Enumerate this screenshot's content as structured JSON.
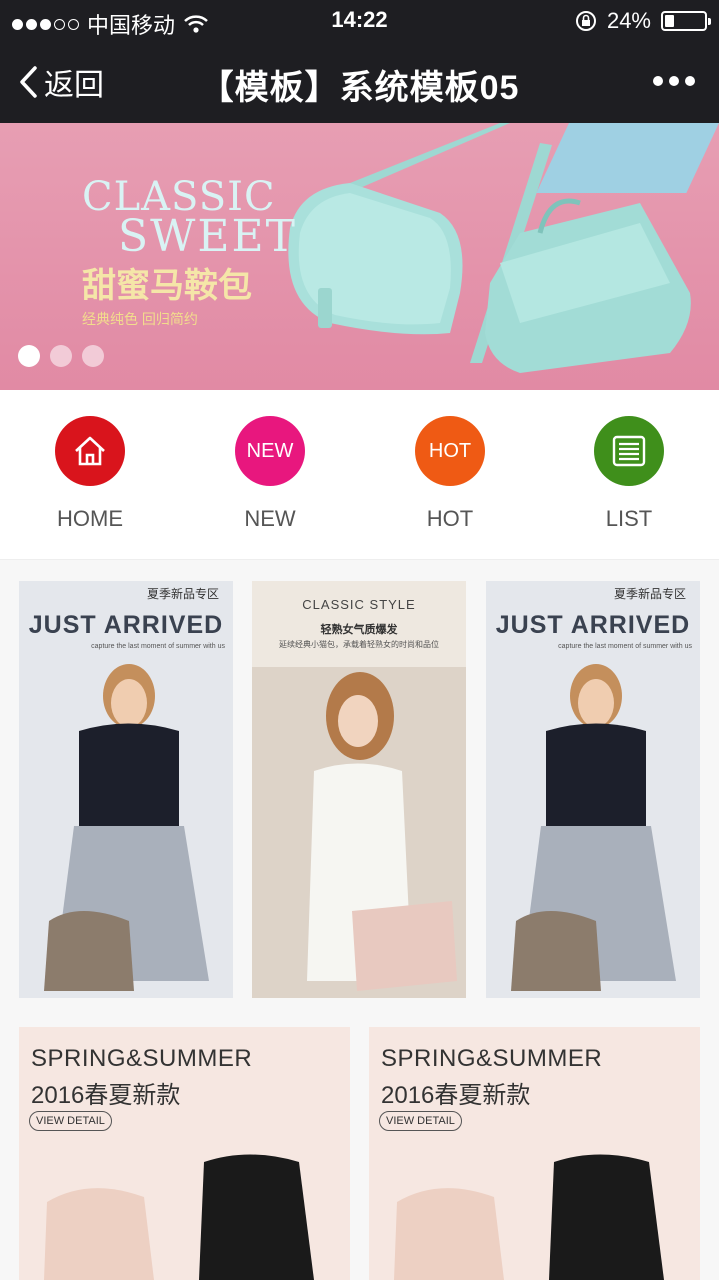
{
  "status_bar": {
    "carrier": "中国移动",
    "time": "14:22",
    "battery": "24%",
    "battery_level": 0.24
  },
  "nav": {
    "back_label": "返回",
    "title": "【模板】系统模板05"
  },
  "banner": {
    "line1": "CLASSIC",
    "line2": "SWEET",
    "line3": "甜蜜马鞍包",
    "line4": "经典纯色 回归简约",
    "active_dot": 0,
    "dot_count": 3
  },
  "quick_nav": [
    {
      "label": "HOME",
      "icon": "home-icon",
      "color": "#d9141c"
    },
    {
      "label": "NEW",
      "icon": "NEW",
      "color": "#e8177e"
    },
    {
      "label": "HOT",
      "icon": "HOT",
      "color": "#ef5a14"
    },
    {
      "label": "LIST",
      "icon": "list-icon",
      "color": "#3f8f1b"
    }
  ],
  "products_row1": [
    {
      "tag": "夏季新品专区",
      "heading": "JUST ARRIVED",
      "sub": "capture the last moment of summer with us"
    },
    {
      "heading": "CLASSIC STYLE",
      "sub1": "轻熟女气质爆发",
      "sub2": "延续经典小猫包，承载着轻熟女的时尚和品位"
    },
    {
      "tag": "夏季新品专区",
      "heading": "JUST ARRIVED",
      "sub": "capture the last moment of summer with us"
    }
  ],
  "products_row2": [
    {
      "title": "SPRING&SUMMER",
      "subtitle": "2016春夏新款",
      "button": "VIEW DETAIL"
    },
    {
      "title": "SPRING&SUMMER",
      "subtitle": "2016春夏新款",
      "button": "VIEW DETAIL"
    }
  ]
}
